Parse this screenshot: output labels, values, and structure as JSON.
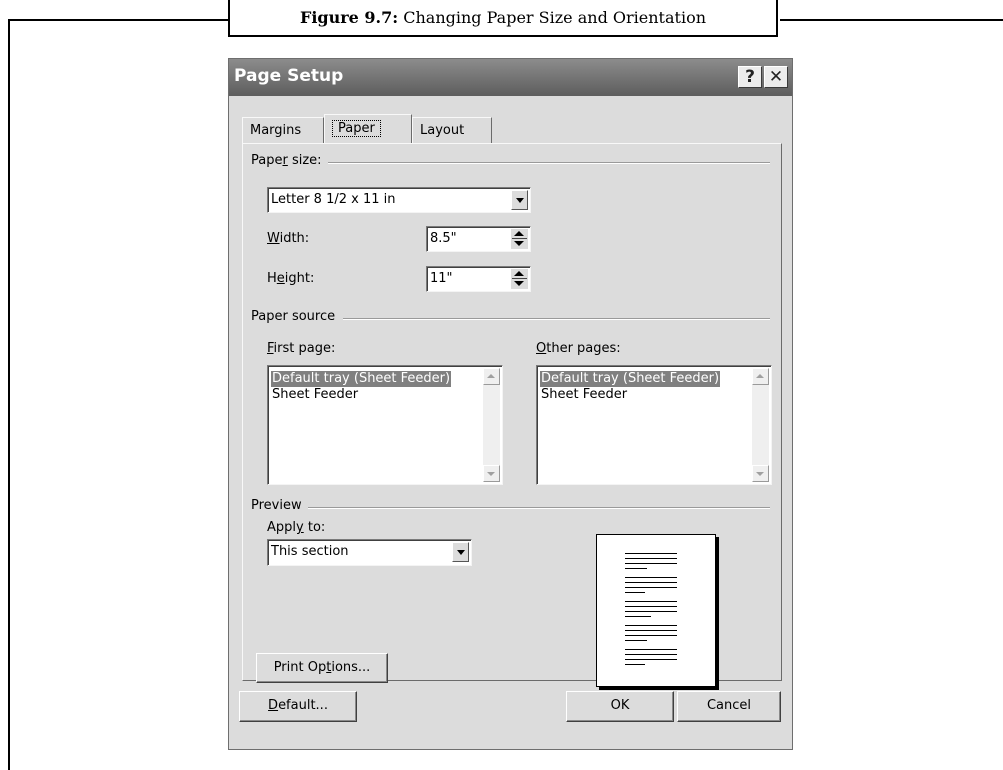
{
  "figure": {
    "caption_label": "Figure 9.7:",
    "caption_text": "Changing Paper Size and Orientation"
  },
  "dialog": {
    "title": "Page Setup",
    "help_glyph": "?",
    "close_glyph": "✕",
    "tabs": [
      {
        "label": "Margins",
        "active": false
      },
      {
        "label": "Paper",
        "active": true
      },
      {
        "label": "Layout",
        "active": false
      }
    ],
    "paper_size": {
      "group_prefix": "Pape",
      "group_accel": "r",
      "group_suffix": " size:",
      "selected": "Letter 8 1/2 x 11 in",
      "width_accel": "W",
      "width_rest": "idth:",
      "width_value": "8.5\"",
      "height_prefix": "H",
      "height_accel": "e",
      "height_rest": "ight:",
      "height_value": "11\""
    },
    "paper_source": {
      "group_label": "Paper source",
      "first_accel": "F",
      "first_rest": "irst page:",
      "other_accel": "O",
      "other_rest": "ther pages:",
      "first_items": [
        "Default tray (Sheet Feeder)",
        "Sheet Feeder"
      ],
      "other_items": [
        "Default tray (Sheet Feeder)",
        "Sheet Feeder"
      ],
      "first_selected_index": 0,
      "other_selected_index": 0
    },
    "preview": {
      "group_label": "Preview",
      "apply_prefix": "Appl",
      "apply_accel": "y",
      "apply_suffix": " to:",
      "apply_value": "This section",
      "print_options_prefix": "Print Op",
      "print_options_accel": "t",
      "print_options_suffix": "ions..."
    },
    "footer": {
      "default_accel": "D",
      "default_rest": "efault...",
      "ok": "OK",
      "cancel": "Cancel"
    }
  }
}
